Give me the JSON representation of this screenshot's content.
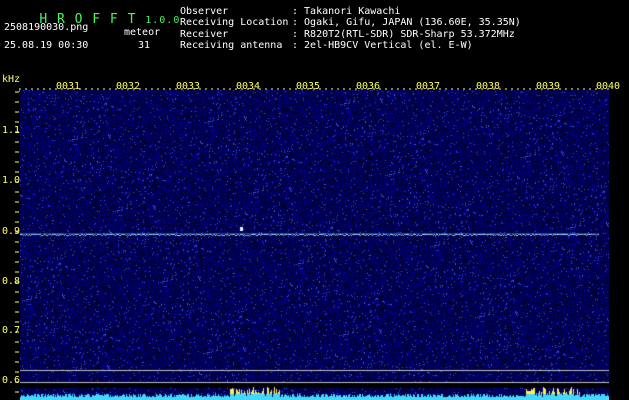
{
  "app": {
    "name": "H R O F F T",
    "version": "1.0.0"
  },
  "file": {
    "name": "2508190030.png",
    "datetime": "25.08.19 00:30"
  },
  "meteor": {
    "label": "meteor",
    "count": "31"
  },
  "info": [
    {
      "label": "Observer",
      "value": ": Takanori Kawachi"
    },
    {
      "label": "Receiving Location",
      "value": ": Ogaki, Gifu, JAPAN (136.60E, 35.35N)"
    },
    {
      "label": "Receiver",
      "value": ": R820T2(RTL-SDR) SDR-Sharp 53.372MHz"
    },
    {
      "label": "Receiving antenna",
      "value": ": 2el-HB9CV Vertical (el. E-W)"
    }
  ],
  "axis": {
    "unit": "kHz",
    "time_ticks": [
      "0031",
      "0032",
      "0033",
      "0034",
      "0035",
      "0036",
      "0037",
      "0038",
      "0039",
      "0040"
    ],
    "freq_ticks": [
      "1.1",
      "1.0",
      "0.9",
      "0.8",
      "0.7",
      "0.6"
    ]
  },
  "colors": {
    "background": "#000000",
    "noise": "#1a1a9a",
    "trace": "#9ee8ff",
    "header_green": "#49f55a",
    "tick_yellow": "#ffff66"
  }
}
